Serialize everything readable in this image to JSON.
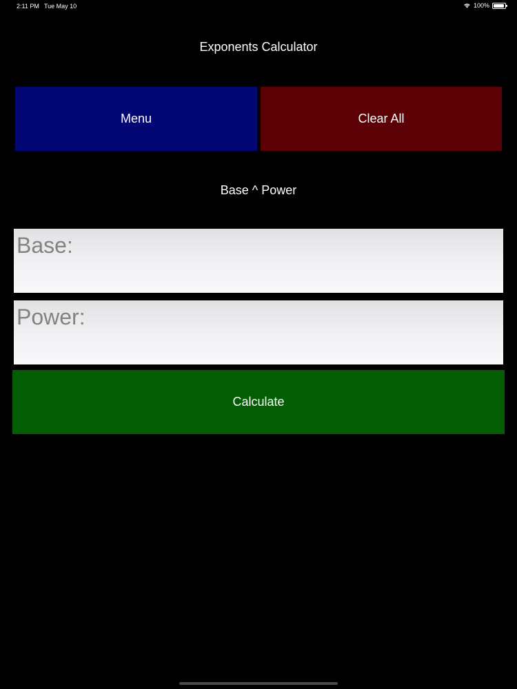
{
  "status_bar": {
    "time": "2:11 PM",
    "date": "Tue May 10",
    "battery": "100%",
    "wifi_icon": "wifi-icon",
    "battery_icon": "battery-icon"
  },
  "page": {
    "title": "Exponents Calculator",
    "formula": "Base ^ Power"
  },
  "toolbar": {
    "menu_label": "Menu",
    "clear_label": "Clear All"
  },
  "form": {
    "base_placeholder": "Base:",
    "base_value": "",
    "power_placeholder": "Power:",
    "power_value": "",
    "calculate_label": "Calculate"
  },
  "colors": {
    "background": "#000000",
    "menu_button": "#020773",
    "clear_button": "#5b0004",
    "calculate_button": "#035d02",
    "field_bg": "#f2f2f4",
    "placeholder_text": "#828282"
  }
}
